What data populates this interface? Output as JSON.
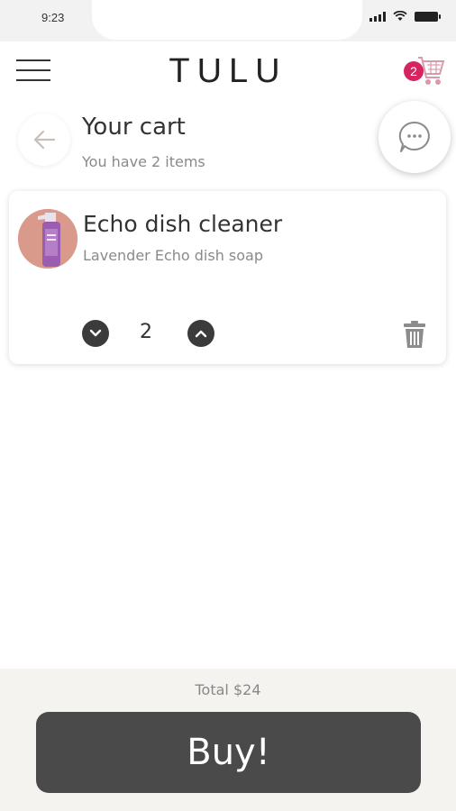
{
  "status_bar": {
    "time": "9:23"
  },
  "header": {
    "brand": "TULU",
    "cart_count": "2",
    "icons": {
      "menu": "hamburger-icon",
      "cart": "cart-icon"
    }
  },
  "page": {
    "title": "Your cart",
    "subtitle": "You have 2 items",
    "icons": {
      "back": "arrow-left-icon",
      "chat": "chat-bubble-icon"
    }
  },
  "cart_items": [
    {
      "name": "Echo dish cleaner",
      "description": "Lavender Echo dish soap",
      "quantity": "2",
      "icons": {
        "decrease": "chevron-down-icon",
        "increase": "chevron-up-icon",
        "delete": "trash-icon"
      }
    }
  ],
  "footer": {
    "total": "Total $24",
    "buy_label": "Buy!"
  },
  "colors": {
    "accent": "#d6245f",
    "button_dark": "#4a4a4a",
    "footer_bg": "#f4f3f0",
    "product_bg": "#d99a8c"
  }
}
